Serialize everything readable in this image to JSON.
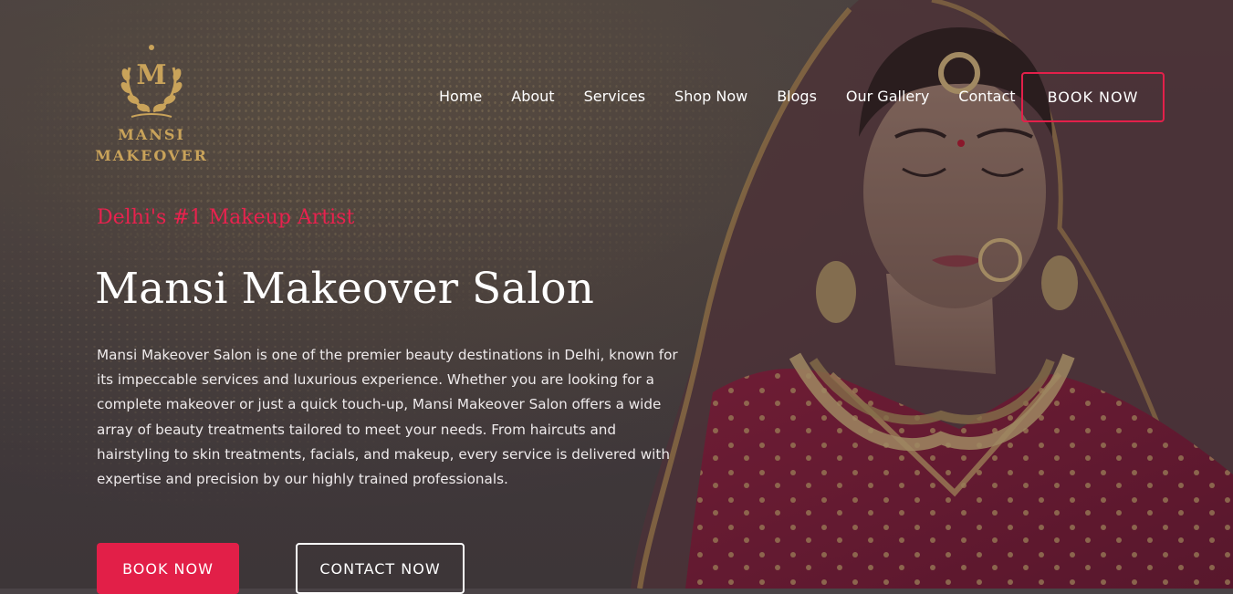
{
  "brand": {
    "logo_letter": "M",
    "name_line1": "MANSI",
    "name_line2": "MAKEOVER",
    "color": "#c9a35a"
  },
  "nav": {
    "items": [
      "Home",
      "About",
      "Services",
      "Shop Now",
      "Blogs",
      "Our Gallery",
      "Contact"
    ],
    "cta": "BOOK NOW"
  },
  "hero": {
    "tagline": "Delhi's #1 Makeup Artist",
    "title": "Mansi Makeover Salon",
    "description": "Mansi Makeover Salon is one of the premier beauty destinations in Delhi, known for its impeccable services and luxurious experience. Whether you are looking for a complete makeover or just a quick touch-up, Mansi Makeover Salon offers a wide array of beauty treatments tailored to meet your needs. From haircuts and hairstyling to skin treatments, facials, and makeup, every service is delivered with expertise and precision by our highly trained professionals.",
    "primary_button": "BOOK NOW",
    "secondary_button": "CONTACT NOW"
  },
  "colors": {
    "accent": "#e21f48",
    "background": "#4a4346",
    "text": "#ffffff"
  }
}
